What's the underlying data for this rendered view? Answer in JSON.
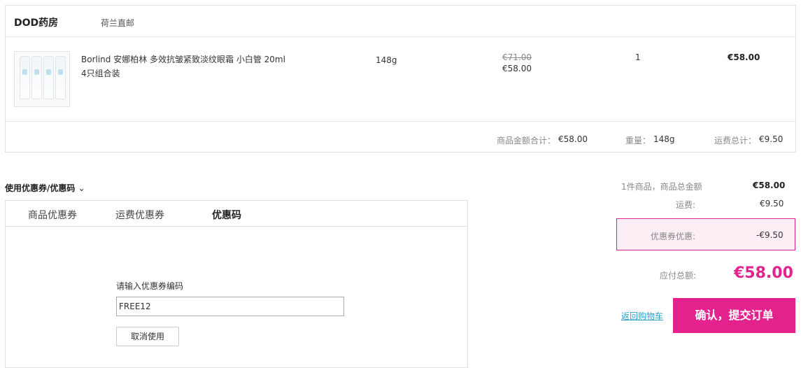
{
  "order": {
    "store_name": "DOD药房",
    "store_tag": "荷兰直邮",
    "product": {
      "name_line1": "Borlind 安娜柏林 多效抗皱紧致淡纹眼霜 小白管 20ml",
      "name_line2": "4只组合装",
      "weight": "148g",
      "original_price": "€71.00",
      "price": "€58.00",
      "quantity": "1",
      "subtotal": "€58.00"
    },
    "summary": {
      "goods_total_label": "商品金额合计：",
      "goods_total_value": "€58.00",
      "weight_label": "重量：",
      "weight_value": "148g",
      "shipping_label": "运费总计：",
      "shipping_value": "€9.50"
    }
  },
  "coupon": {
    "toggle_label": "使用优惠券/优惠码",
    "tabs": [
      "商品优惠券",
      "运费优惠券",
      "优惠码"
    ],
    "active_tab": "优惠码",
    "input_label": "请输入优惠券编码",
    "input_value": "FREE12",
    "cancel_label": "取消使用"
  },
  "totals": {
    "items_label": "1件商品，商品总金额",
    "items_value": "€58.00",
    "shipping_label": "运费:",
    "shipping_value": "€9.50",
    "discount_label": "优惠券优惠:",
    "discount_value": "-€9.50",
    "payable_label": "应付总额:",
    "payable_value": "€58.00",
    "back_label": "返回购物车",
    "submit_label": "确认，提交订单"
  },
  "colors": {
    "accent": "#e3228e",
    "link": "#2aa0c9"
  }
}
